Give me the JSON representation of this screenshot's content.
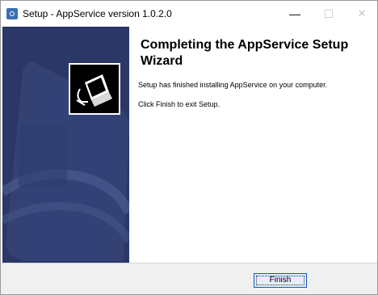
{
  "window": {
    "title": "Setup - AppService version 1.0.2.0",
    "controls": {
      "minimize": "—",
      "maximize": "☐",
      "close": "✕"
    }
  },
  "content": {
    "heading": "Completing the AppService Setup Wizard",
    "line1": "Setup has finished installing AppService on your computer.",
    "line2": "Click Finish to exit Setup."
  },
  "footer": {
    "finish_label": "Finish"
  },
  "colors": {
    "sidebar": "#2a3767",
    "accent": "#0a58c8"
  },
  "icons": [
    "setup-app-icon",
    "installer-computer-icon"
  ]
}
